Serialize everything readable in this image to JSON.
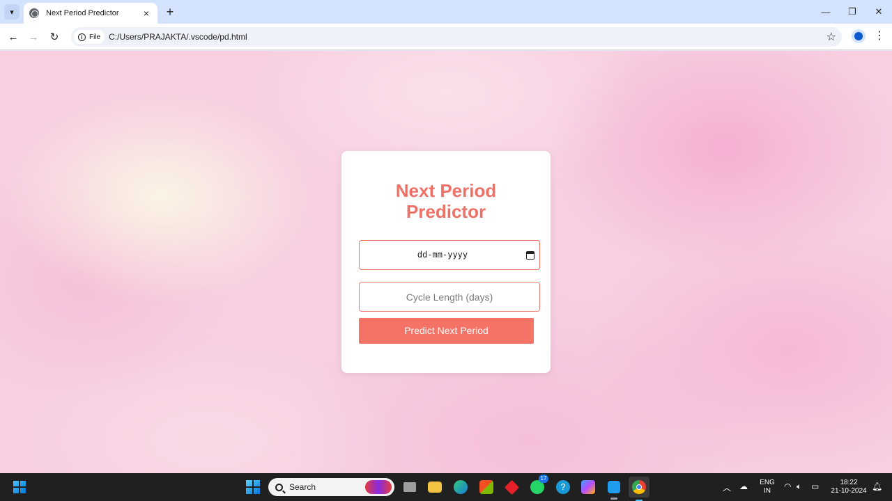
{
  "browser": {
    "tab_title": "Next Period Predictor",
    "url_scheme_label": "File",
    "url": "C:/Users/PRAJAKTA/.vscode/pd.html",
    "icons": [
      "tab-list-icon",
      "globe-icon",
      "close-icon",
      "plus-icon",
      "minimize-icon",
      "maximize-icon",
      "close-window-icon",
      "back-icon",
      "forward-icon",
      "reload-icon",
      "info-icon",
      "star-icon",
      "profile-icon",
      "menu-icon"
    ]
  },
  "page": {
    "title": "Next Period Predictor",
    "date_input": {
      "display": "dd-mm-yyyy"
    },
    "cycle_input": {
      "placeholder": "Cycle Length (days)",
      "value": ""
    },
    "predict_button": "Predict Next Period",
    "colors": {
      "accent": "#ee7167",
      "button": "#f57266",
      "field_border": "#f08078",
      "background": "#f7cfe1"
    }
  },
  "taskbar": {
    "search_label": "Search",
    "whatsapp_badge": "17",
    "lang_top": "ENG",
    "lang_bottom": "IN",
    "time": "18:22",
    "date": "21-10-2024",
    "apps": [
      "windows-start",
      "file-explorer",
      "edge",
      "microsoft-store",
      "app-red",
      "whatsapp",
      "help",
      "copilot",
      "vscode",
      "chrome"
    ]
  }
}
